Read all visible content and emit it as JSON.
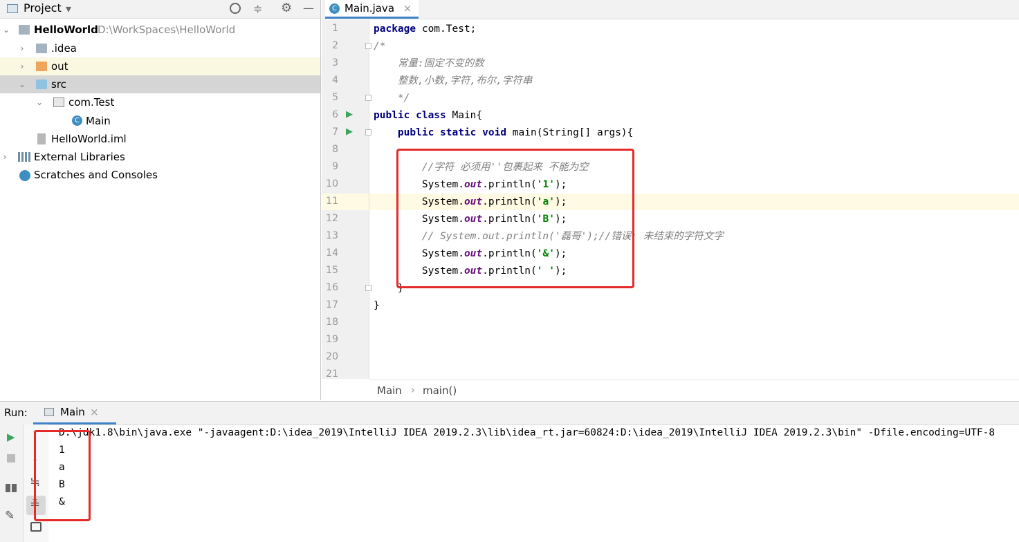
{
  "project_panel": {
    "title": "Project",
    "tree": [
      {
        "label": "HelloWorld",
        "path": "D:\\WorkSpaces\\HelloWorld",
        "expanded": true
      },
      {
        "label": ".idea"
      },
      {
        "label": "out"
      },
      {
        "label": "src"
      },
      {
        "label": "com.Test"
      },
      {
        "label": "Main"
      },
      {
        "label": "HelloWorld.iml"
      },
      {
        "label": "External Libraries"
      },
      {
        "label": "Scratches and Consoles"
      }
    ]
  },
  "editor": {
    "tab_label": "Main.java",
    "line_numbers": [
      "1",
      "2",
      "3",
      "4",
      "5",
      "6",
      "7",
      "8",
      "9",
      "10",
      "11",
      "12",
      "13",
      "14",
      "15",
      "16",
      "17",
      "18",
      "19",
      "20",
      "21"
    ],
    "code": {
      "l1_kw": "package",
      "l1_rest": " com.Test;",
      "l2": "/*",
      "l3": "    常量:固定不变的数",
      "l4": "    整数,小数,字符,布尔,字符串",
      "l5": "    */",
      "l6_kw": "public class",
      "l6_rest": " Main{",
      "l7_kw": "    public static void",
      "l7_rest": " main(String[] args){",
      "l9": "        //字符 必须用''包裹起来 不能为空",
      "sys": "        System.",
      "out": "out",
      "println_open": ".println(",
      "close": ");",
      "l10_str": "'1'",
      "l11_str": "'a'",
      "l12_str": "'B'",
      "l13": "        // System.out.println('磊哥');//错误: 未结束的字符文字",
      "l14_str": "'&'",
      "l15_str": "' '",
      "l16": "    }",
      "l17": "}"
    },
    "breadcrumb": [
      "Main",
      "main()"
    ],
    "breadcrumb_sep": "›"
  },
  "run_panel": {
    "label": "Run:",
    "tab_label": "Main",
    "command": "D:\\jdk1.8\\bin\\java.exe \"-javaagent:D:\\idea_2019\\IntelliJ IDEA 2019.2.3\\lib\\idea_rt.jar=60824:D:\\idea_2019\\IntelliJ IDEA 2019.2.3\\bin\" -Dfile.encoding=UTF-8",
    "output": [
      "1",
      "a",
      "B",
      "&"
    ]
  },
  "icons": {
    "close": "×",
    "chevron_down": "▾",
    "expand": "›",
    "run": "▶",
    "gear": "⚙",
    "minimize": "—"
  },
  "colors": {
    "highlight_box": "#e52a2a",
    "accent": "#4083c9"
  }
}
